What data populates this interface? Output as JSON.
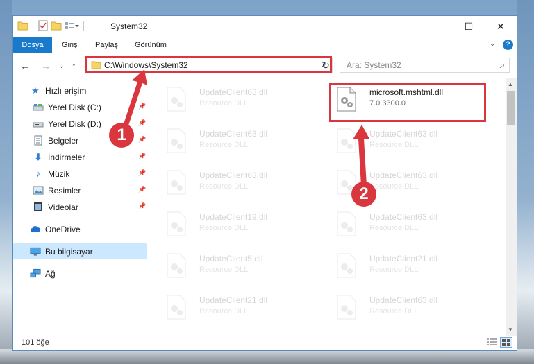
{
  "window": {
    "title": "System32",
    "controls": {
      "minimize": "—",
      "maximize": "☐",
      "close": "✕"
    }
  },
  "ribbon": {
    "tabs": [
      {
        "label": "Dosya"
      },
      {
        "label": "Giriş"
      },
      {
        "label": "Paylaş"
      },
      {
        "label": "Görünüm"
      }
    ],
    "help": "?"
  },
  "address_bar": {
    "path": "C:\\Windows\\System32"
  },
  "search": {
    "placeholder": "Ara: System32"
  },
  "sidebar": {
    "items": [
      {
        "label": "Hızlı erişim",
        "icon": "star-icon"
      },
      {
        "label": "Yerel Disk (C:)",
        "icon": "drive-icon"
      },
      {
        "label": "Yerel Disk (D:)",
        "icon": "drive-icon"
      },
      {
        "label": "Belgeler",
        "icon": "documents-icon"
      },
      {
        "label": "İndirmeler",
        "icon": "downloads-icon"
      },
      {
        "label": "Müzik",
        "icon": "music-icon"
      },
      {
        "label": "Resimler",
        "icon": "pictures-icon"
      },
      {
        "label": "Videolar",
        "icon": "videos-icon"
      },
      {
        "label": "OneDrive",
        "icon": "cloud-icon"
      },
      {
        "label": "Bu bilgisayar",
        "icon": "computer-icon"
      },
      {
        "label": "Ağ",
        "icon": "network-icon"
      }
    ]
  },
  "files": [
    {
      "name": "UpdateClient63.dll",
      "type": "Resource DLL"
    },
    {
      "name": "microsoft.mshtml.dll",
      "type": "7.0.3300.0"
    },
    {
      "name": "UpdateClient63.dll",
      "type": "Resource DLL"
    },
    {
      "name": "UpdateClient63.dll",
      "type": "Resource DLL"
    },
    {
      "name": "UpdateClient63.dll",
      "type": "Resource DLL"
    },
    {
      "name": "UpdateClient63.dll",
      "type": "Resource DLL"
    },
    {
      "name": "UpdateClient19.dll",
      "type": "Resource DLL"
    },
    {
      "name": "UpdateClient63.dll",
      "type": "Resource DLL"
    },
    {
      "name": "UpdateClient5.dll",
      "type": "Resource DLL"
    },
    {
      "name": "UpdateClient21.dll",
      "type": "Resource DLL"
    },
    {
      "name": "UpdateClient21.dll",
      "type": "Resource DLL"
    },
    {
      "name": "UpdateClient63.dll",
      "type": "Resource DLL"
    }
  ],
  "status": {
    "item_count": "101 öğe"
  },
  "annotations": {
    "step1": "1",
    "step2": "2"
  },
  "colors": {
    "accent": "#1979ca",
    "highlight": "#d9363e",
    "selection": "#cce8ff"
  }
}
